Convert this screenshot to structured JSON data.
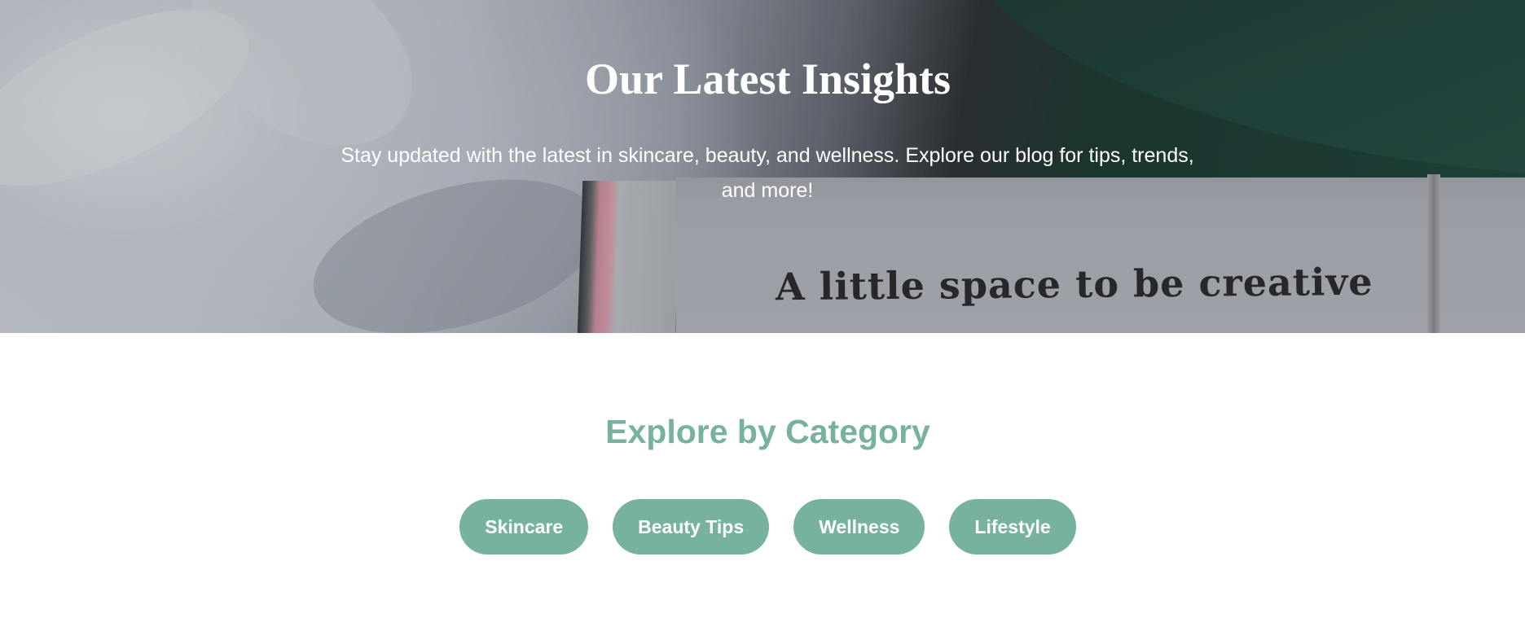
{
  "hero": {
    "title": "Our Latest Insights",
    "subtitle": "Stay updated with the latest in skincare, beauty, and wellness. Explore our blog for tips, trends, and more!",
    "image_text": "A little space to be creative"
  },
  "categories": {
    "title": "Explore by Category",
    "buttons": [
      {
        "label": "Skincare"
      },
      {
        "label": "Beauty Tips"
      },
      {
        "label": "Wellness"
      },
      {
        "label": "Lifestyle"
      }
    ]
  },
  "colors": {
    "accent": "#77b39c",
    "hero_text": "#ffffff"
  }
}
